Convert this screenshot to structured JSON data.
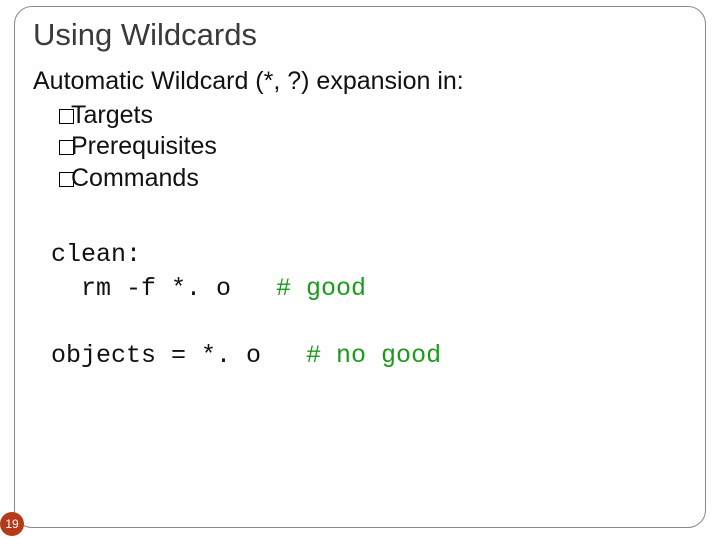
{
  "slide": {
    "title": "Using Wildcards",
    "intro": "Automatic Wildcard (*, ?) expansion in:",
    "bullets": [
      "Targets",
      "Prerequisites",
      "Commands"
    ],
    "code1_line1": "clean:",
    "code1_line2_cmd": "  rm -f *. o   ",
    "code1_line2_comment": "# good",
    "code2_cmd": "objects = *. o   ",
    "code2_comment": "# no good",
    "page_number": "19"
  }
}
